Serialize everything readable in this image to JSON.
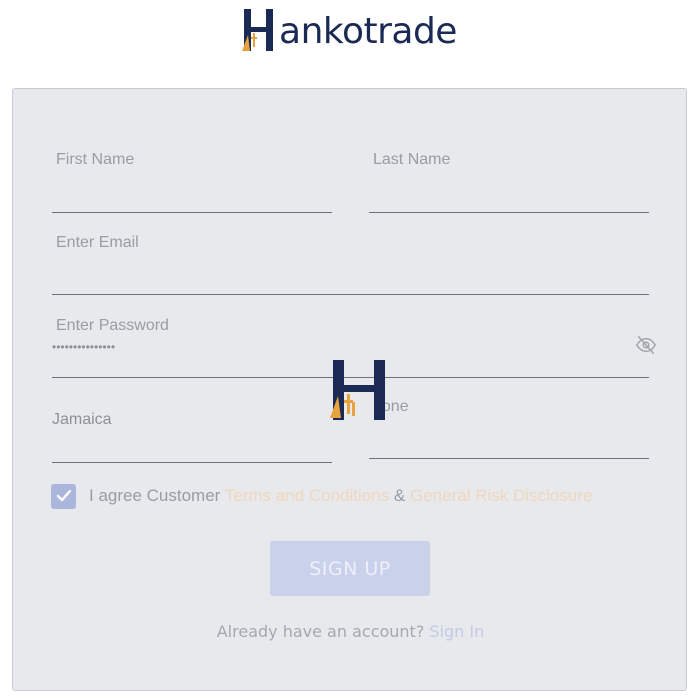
{
  "brand": {
    "name": "Hankotrade",
    "logo_text": "ankotrade",
    "navy": "#1b2a55",
    "orange": "#e8a33c"
  },
  "form": {
    "first_name": {
      "placeholder": "First Name"
    },
    "last_name": {
      "placeholder": "Last Name"
    },
    "email": {
      "placeholder": "Enter Email"
    },
    "password": {
      "placeholder": "Enter Password",
      "value": "•••••••••••••••",
      "toggle_icon": "eye-slash-icon"
    },
    "country": {
      "value": "Jamaica"
    },
    "phone": {
      "placeholder": "Phone",
      "visible_text": "hone"
    }
  },
  "agreement": {
    "checked": true,
    "prefix": "I agree Customer",
    "terms_link": "Terms and Conditions",
    "ampersand": "&",
    "risk_link": "General Risk Disclosure"
  },
  "signup_button": {
    "label": "SIGN UP"
  },
  "footer": {
    "already_text": "Already have an account?",
    "signin_link": "Sign In"
  },
  "loading_overlay": {
    "icon": "hankotrade-h-logo-icon"
  }
}
